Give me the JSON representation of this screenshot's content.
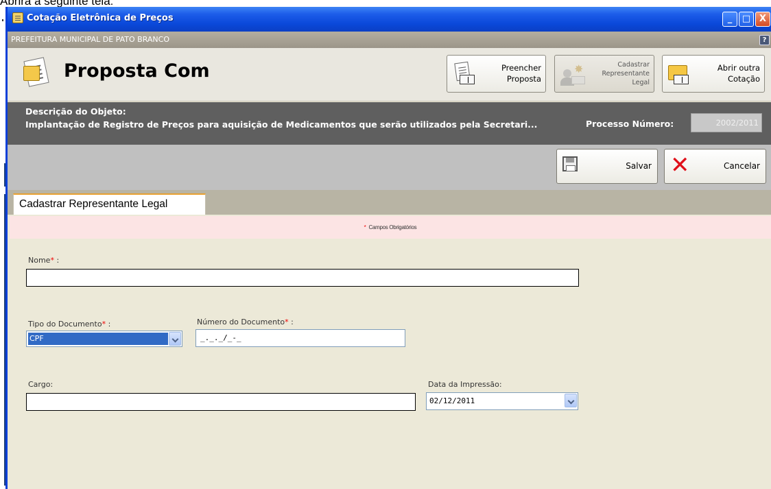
{
  "doc_snippet": "Abrirá a seguinte tela:",
  "window": {
    "title": "Cotação Eletrônica de Preços",
    "buttons": {
      "minimize": "_",
      "maximize": "□",
      "close": "X"
    }
  },
  "org": {
    "name": "PREFEITURA MUNICIPAL DE PATO BRANCO",
    "help": "?"
  },
  "header": {
    "title": "Proposta Com",
    "toolbar": {
      "preencher": "Preencher\nProposta",
      "cadastrar": "Cadastrar\nRepresentante\nLegal",
      "abrir": "Abrir outra\nCotação"
    }
  },
  "objeto": {
    "label": "Descrição do Objeto:",
    "text": "Implantação de Registro de Preços para aquisição de Medicamentos que serão utilizados pela Secretari...",
    "processo_label": "Processo Número:",
    "processo_value": "2002/2011"
  },
  "actions": {
    "salvar": "Salvar",
    "cancelar": "Cancelar"
  },
  "tab": {
    "label": "Cadastrar Representante Legal"
  },
  "form": {
    "required_note": "Campos Obrigatórios",
    "required_mark": "*",
    "nome_label": "Nome",
    "nome_value": "",
    "tipo_label": "Tipo do Documento",
    "tipo_value": "CPF",
    "numero_label": "Número do Documento",
    "numero_value": "_._._/_-_",
    "cargo_label": "Cargo:",
    "cargo_value": "",
    "data_label": "Data da Impressão:",
    "data_value": "02/12/2011",
    "colon": " :"
  }
}
